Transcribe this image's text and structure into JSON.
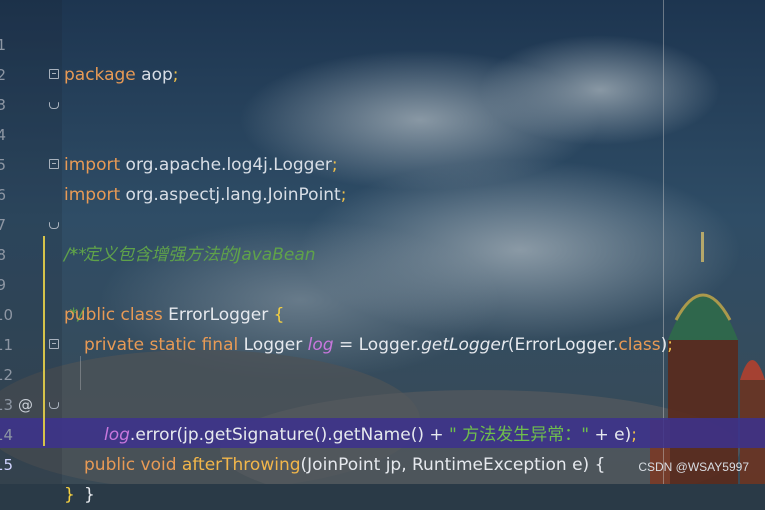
{
  "editor": {
    "lines": [
      {
        "n": "1"
      },
      {
        "n": "2"
      },
      {
        "n": "3"
      },
      {
        "n": "4"
      },
      {
        "n": "5"
      },
      {
        "n": "6"
      },
      {
        "n": "7"
      },
      {
        "n": "8"
      },
      {
        "n": "9"
      },
      {
        "n": "10"
      },
      {
        "n": "11"
      },
      {
        "n": "12"
      },
      {
        "n": "13"
      },
      {
        "n": "14"
      },
      {
        "n": "15"
      }
    ],
    "code": {
      "l1_kw": "package",
      "l1_pkg": " aop",
      "semi": ";",
      "l3_kw": "import",
      "l3_pkg": " org.apache.log4j.Logger",
      "l4_kw": "import",
      "l4_pkg": " org.aspectj.lang.JoinPoint",
      "l6": "/**",
      "l7": " * 定义包含增强方法的JavaBean",
      "l8": " */",
      "l9_kw": "public class",
      "l9_cls": " ErrorLogger ",
      "l9_brace": "{",
      "l10_kw": "private static final",
      "l10_type": " Logger ",
      "l10_field": "log",
      "l10_eq": " = Logger.",
      "l10_call": "getLogger",
      "l10_args": "(ErrorLogger.",
      "l10_class": "class",
      "l10_close": ")",
      "l12_kw": "public void",
      "l12_fn": " afterThrowing",
      "l12_args": "(JoinPoint jp, RuntimeException e) {",
      "l13_field": "log",
      "l13_call": ".error(jp.getSignature().getName() + ",
      "l13_str": "\" 方法发生异常：\"",
      "l13_rest": " + e)",
      "l14": "}",
      "l15": "}"
    },
    "gutter_marker": "@"
  },
  "watermark": "CSDN @WSAY5997",
  "colors": {
    "keyword": "#e89a55",
    "comment": "#5fa24a",
    "field": "#c877dd",
    "method": "#f2b64a",
    "string": "#6fbf4c",
    "current_line": "#3c328c"
  }
}
